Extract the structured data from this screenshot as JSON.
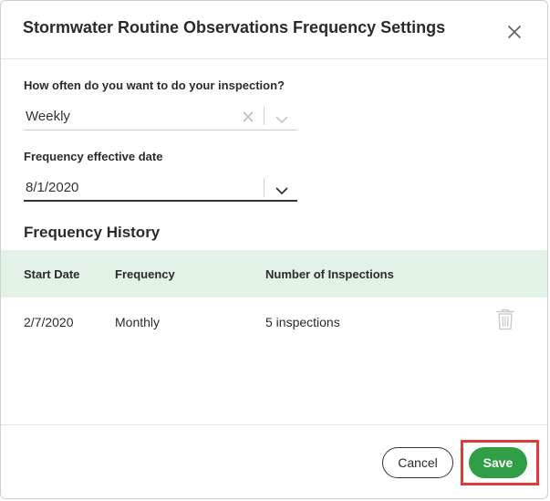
{
  "dialog": {
    "title": "Stormwater Routine Observations Frequency Settings"
  },
  "form": {
    "frequency_label": "How often do you want to do your inspection?",
    "frequency_value": "Weekly",
    "effective_date_label": "Frequency effective date",
    "effective_date_value": "8/1/2020"
  },
  "history": {
    "title": "Frequency History",
    "columns": [
      "Start Date",
      "Frequency",
      "Number of Inspections"
    ],
    "rows": [
      {
        "start_date": "2/7/2020",
        "frequency": "Monthly",
        "inspections": "5 inspections"
      }
    ]
  },
  "footer": {
    "cancel_label": "Cancel",
    "save_label": "Save"
  },
  "icons": {
    "close": "close-icon",
    "clear": "clear-icon",
    "dropdown": "chevron-down-icon",
    "delete": "trash-icon"
  },
  "colors": {
    "accent_green": "#2f9e44",
    "table_header_bg": "#e3f2e6",
    "highlight_red": "#e03a3a"
  }
}
